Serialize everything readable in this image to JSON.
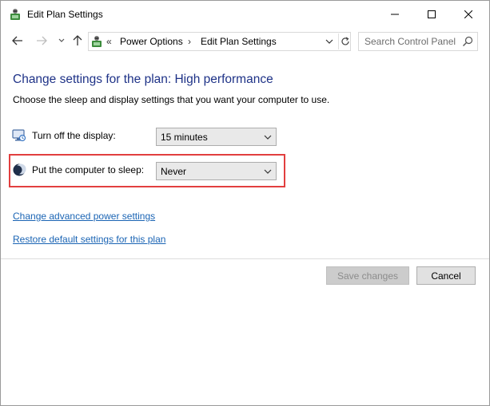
{
  "window": {
    "title": "Edit Plan Settings"
  },
  "titlebar": {
    "buttons": [
      "minimize-icon",
      "maximize-icon",
      "close-icon"
    ]
  },
  "navigation": {
    "breadcrumb_prefix": "«",
    "crumbs": [
      "Power Options",
      "Edit Plan Settings"
    ],
    "crumb_separator": "›",
    "search_placeholder": "Search Control Panel"
  },
  "main": {
    "heading": "Change settings for the plan: High performance",
    "subheading": "Choose the sleep and display settings that you want your computer to use.",
    "settings": [
      {
        "label": "Turn off the display:",
        "value": "15 minutes",
        "icon": "display-icon"
      },
      {
        "label": "Put the computer to sleep:",
        "value": "Never",
        "icon": "sleep-moon-icon"
      }
    ],
    "links": [
      "Change advanced power settings",
      "Restore default settings for this plan"
    ]
  },
  "footer": {
    "save_label": "Save changes",
    "cancel_label": "Cancel"
  },
  "colors": {
    "heading": "#1e3287",
    "link": "#1a64b4",
    "highlight_border": "#e23f3f"
  }
}
